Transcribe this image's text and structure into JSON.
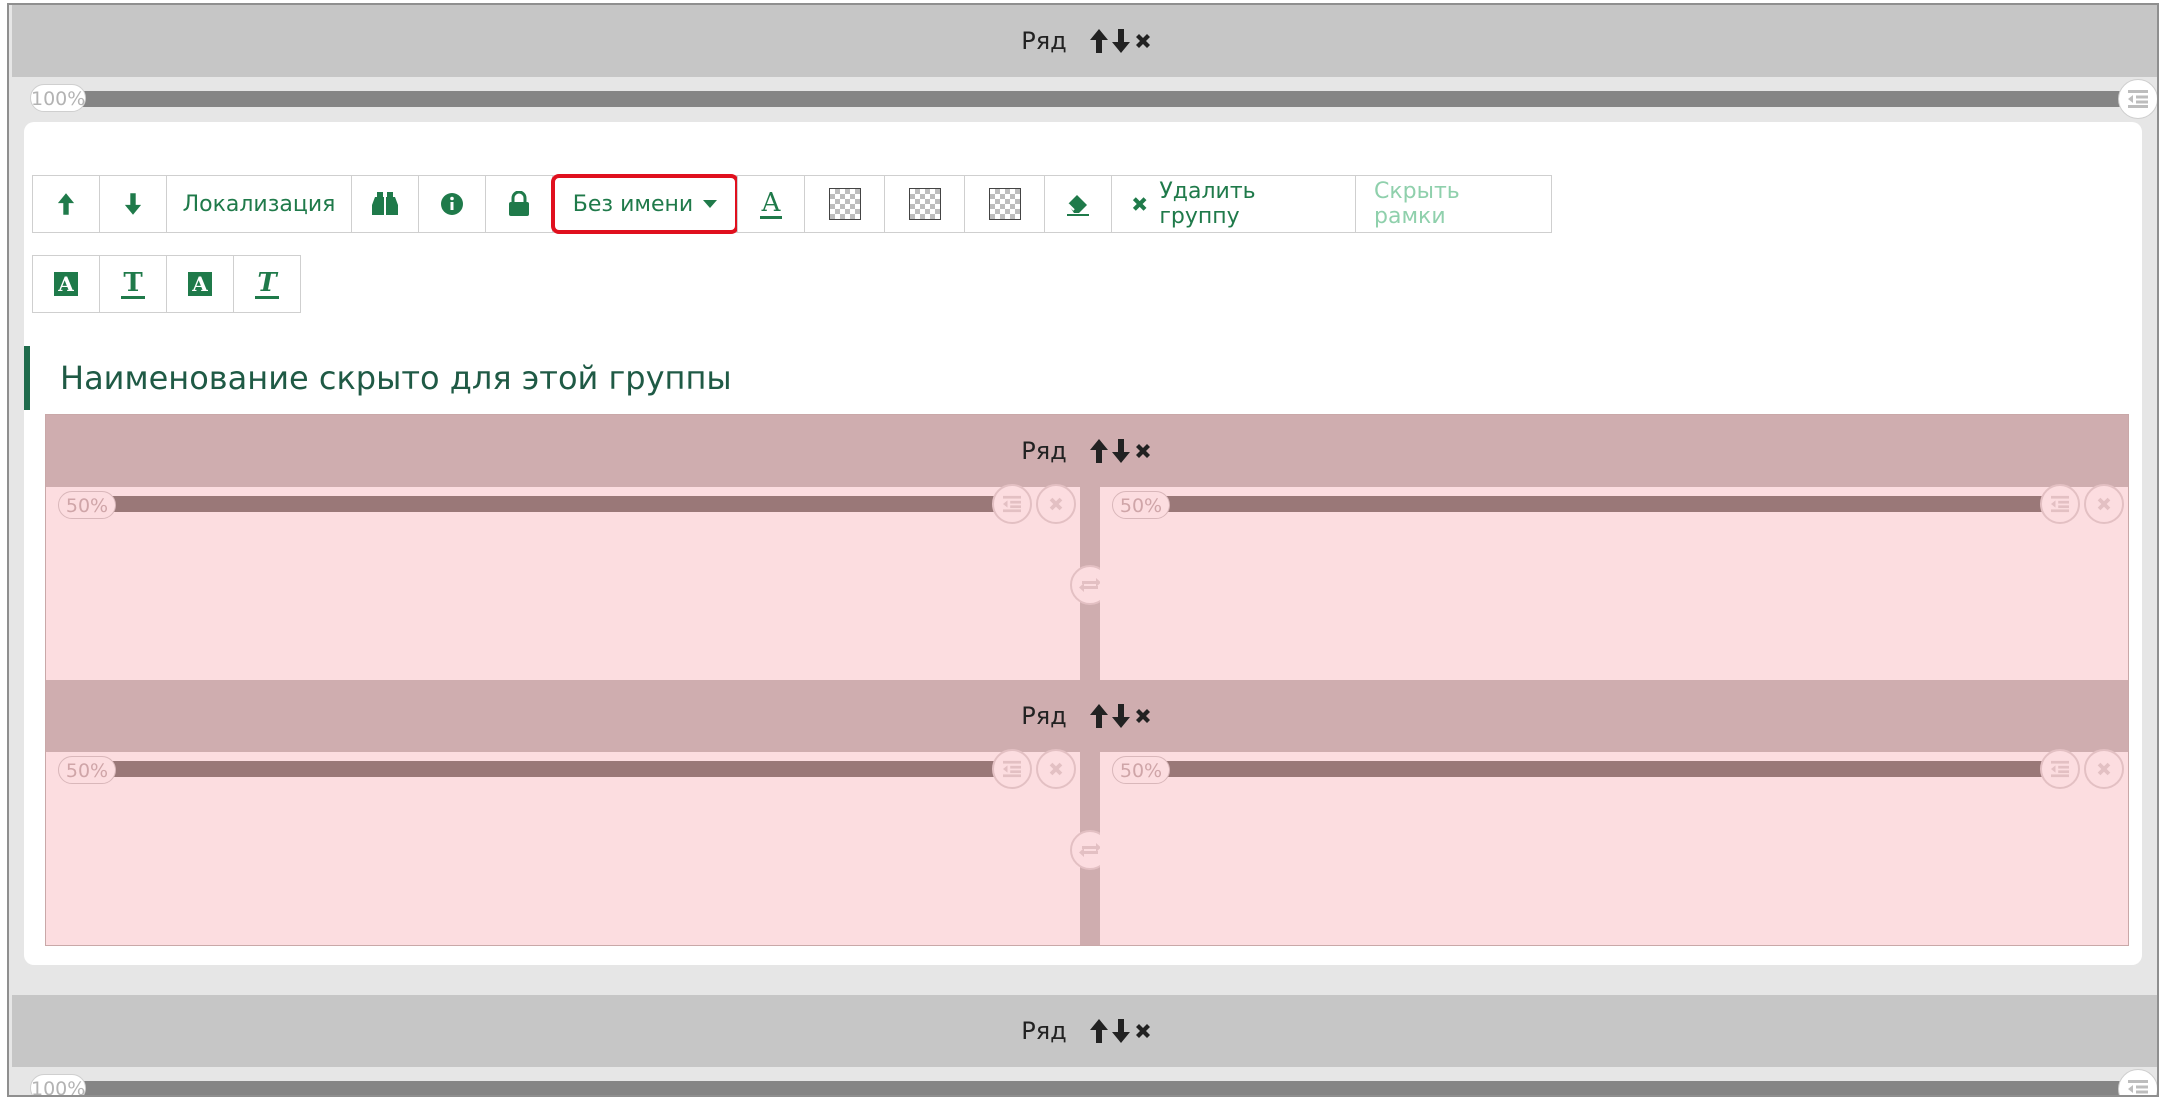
{
  "rows": [
    {
      "label": "Ряд",
      "width_percent": "100%"
    },
    {
      "label": "Ряд",
      "width_percent": "100%"
    }
  ],
  "toolbar": {
    "move_up": "move-up",
    "move_down": "move-down",
    "localization_label": "Локализация",
    "name_dropdown_label": "Без имени",
    "delete_group_label": "Удалить группу",
    "hide_frames_label": "Скрыть рамки"
  },
  "group": {
    "title": "Наименование скрыто для этой группы",
    "nested_rows": [
      {
        "label": "Ряд",
        "columns": [
          {
            "width_percent": "50%"
          },
          {
            "width_percent": "50%"
          }
        ]
      },
      {
        "label": "Ряд",
        "columns": [
          {
            "width_percent": "50%"
          },
          {
            "width_percent": "50%"
          }
        ]
      }
    ]
  },
  "colors": {
    "accent_green": "#1f7a4a",
    "highlight_red": "#e0101e",
    "row_gray": "#c6c6c6",
    "nested_row_pink": "#cfadaf",
    "column_pink": "#fcdde0"
  }
}
